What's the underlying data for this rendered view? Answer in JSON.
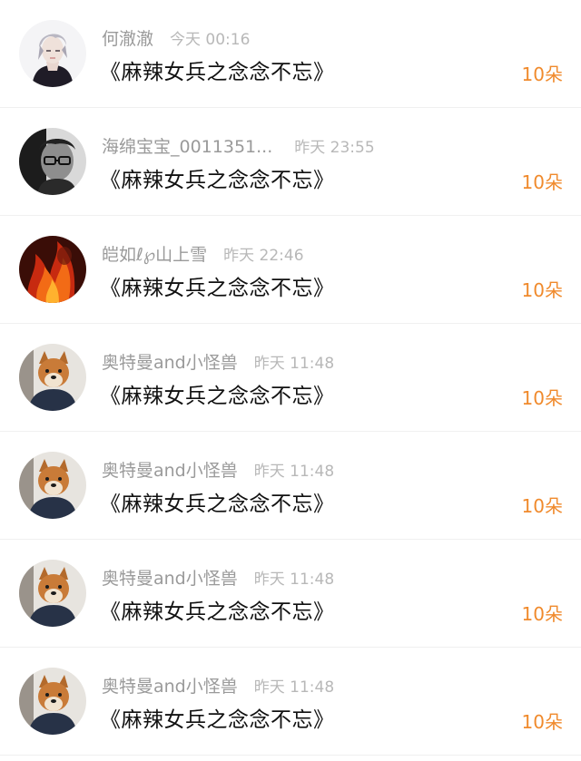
{
  "colors": {
    "accent": "#f08a2c",
    "name_text": "#9a9a9a",
    "time_text": "#b8b8b8",
    "message_text": "#111111",
    "divider": "#f0f0f0"
  },
  "items": [
    {
      "name": "何澈澈",
      "time": "今天 00:16",
      "message": "《麻辣女兵之念念不忘》",
      "gift": "10朵",
      "avatar": "anime-boy-avatar"
    },
    {
      "name": "海绵宝宝_0011351...",
      "time": "昨天 23:55",
      "message": "《麻辣女兵之念念不忘》",
      "gift": "10朵",
      "avatar": "bw-man-glasses-avatar"
    },
    {
      "name": "皑如ℓ℘山上雪",
      "time": "昨天 22:46",
      "message": "《麻辣女兵之念念不忘》",
      "gift": "10朵",
      "avatar": "fire-avatar"
    },
    {
      "name": "奥特曼and小怪兽",
      "time": "昨天 11:48",
      "message": "《麻辣女兵之念念不忘》",
      "gift": "10朵",
      "avatar": "shiba-dog-avatar"
    },
    {
      "name": "奥特曼and小怪兽",
      "time": "昨天 11:48",
      "message": "《麻辣女兵之念念不忘》",
      "gift": "10朵",
      "avatar": "shiba-dog-avatar"
    },
    {
      "name": "奥特曼and小怪兽",
      "time": "昨天 11:48",
      "message": "《麻辣女兵之念念不忘》",
      "gift": "10朵",
      "avatar": "shiba-dog-avatar"
    },
    {
      "name": "奥特曼and小怪兽",
      "time": "昨天 11:48",
      "message": "《麻辣女兵之念念不忘》",
      "gift": "10朵",
      "avatar": "shiba-dog-avatar"
    }
  ]
}
